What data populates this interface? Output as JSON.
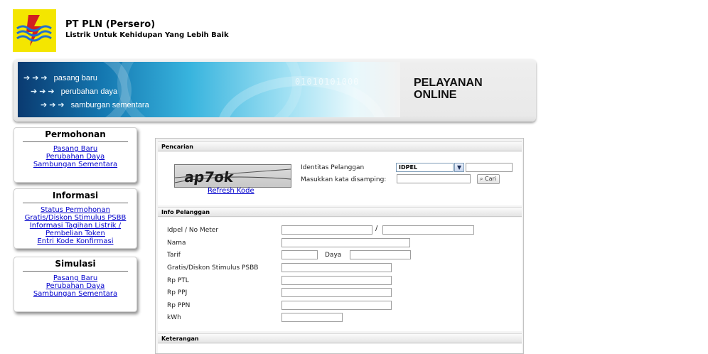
{
  "company": {
    "name": "PT PLN (Persero)",
    "tagline": "Listrik Untuk Kehidupan Yang Lebih Baik"
  },
  "banner": {
    "links": [
      "pasang baru",
      "perubahan daya",
      "samburgan sementara"
    ],
    "title_line1": "PELAYANAN",
    "title_line2": "ONLINE"
  },
  "sidebar": {
    "permohonan": {
      "title": "Permohonan",
      "items": [
        "Pasang Baru",
        "Perubahan Daya",
        "Sambungan Sementara"
      ]
    },
    "informasi": {
      "title": "Informasi",
      "items": [
        "Status Permohonan",
        "Gratis/Diskon Stimulus PSBB",
        "Informasi Tagihan Listrik /",
        "Pembelian Token",
        "Entri Kode Konfirmasi"
      ]
    },
    "simulasi": {
      "title": "Simulasi",
      "items": [
        "Pasang Baru",
        "Perubahan Daya",
        "Sambungan Sementara"
      ]
    }
  },
  "pencarian": {
    "header": "Pencarian",
    "refresh_label": "Refresh Kode",
    "identitas_label": "Identitas Pelanggan",
    "identitas_select_value": "IDPEL",
    "captcha_label": "Masukkan kata disamping:",
    "search_button": "Cari"
  },
  "info_pelanggan": {
    "header": "Info Pelanggan",
    "idpel_label": "Idpel / No Meter",
    "separator": "/",
    "nama_label": "Nama",
    "tarif_label": "Tarif",
    "daya_label": "Daya",
    "gratis_label": "Gratis/Diskon Stimulus PSBB",
    "ptl_label": "Rp PTL",
    "ppj_label": "Rp PPJ",
    "ppn_label": "Rp PPN",
    "kwh_label": "kWh"
  },
  "keterangan": {
    "header": "Keterangan"
  },
  "colors": {
    "logo_bg": "#f4e600",
    "link": "#0000cc",
    "banner_dark": "#0a3a70",
    "banner_light": "#38b4de"
  }
}
